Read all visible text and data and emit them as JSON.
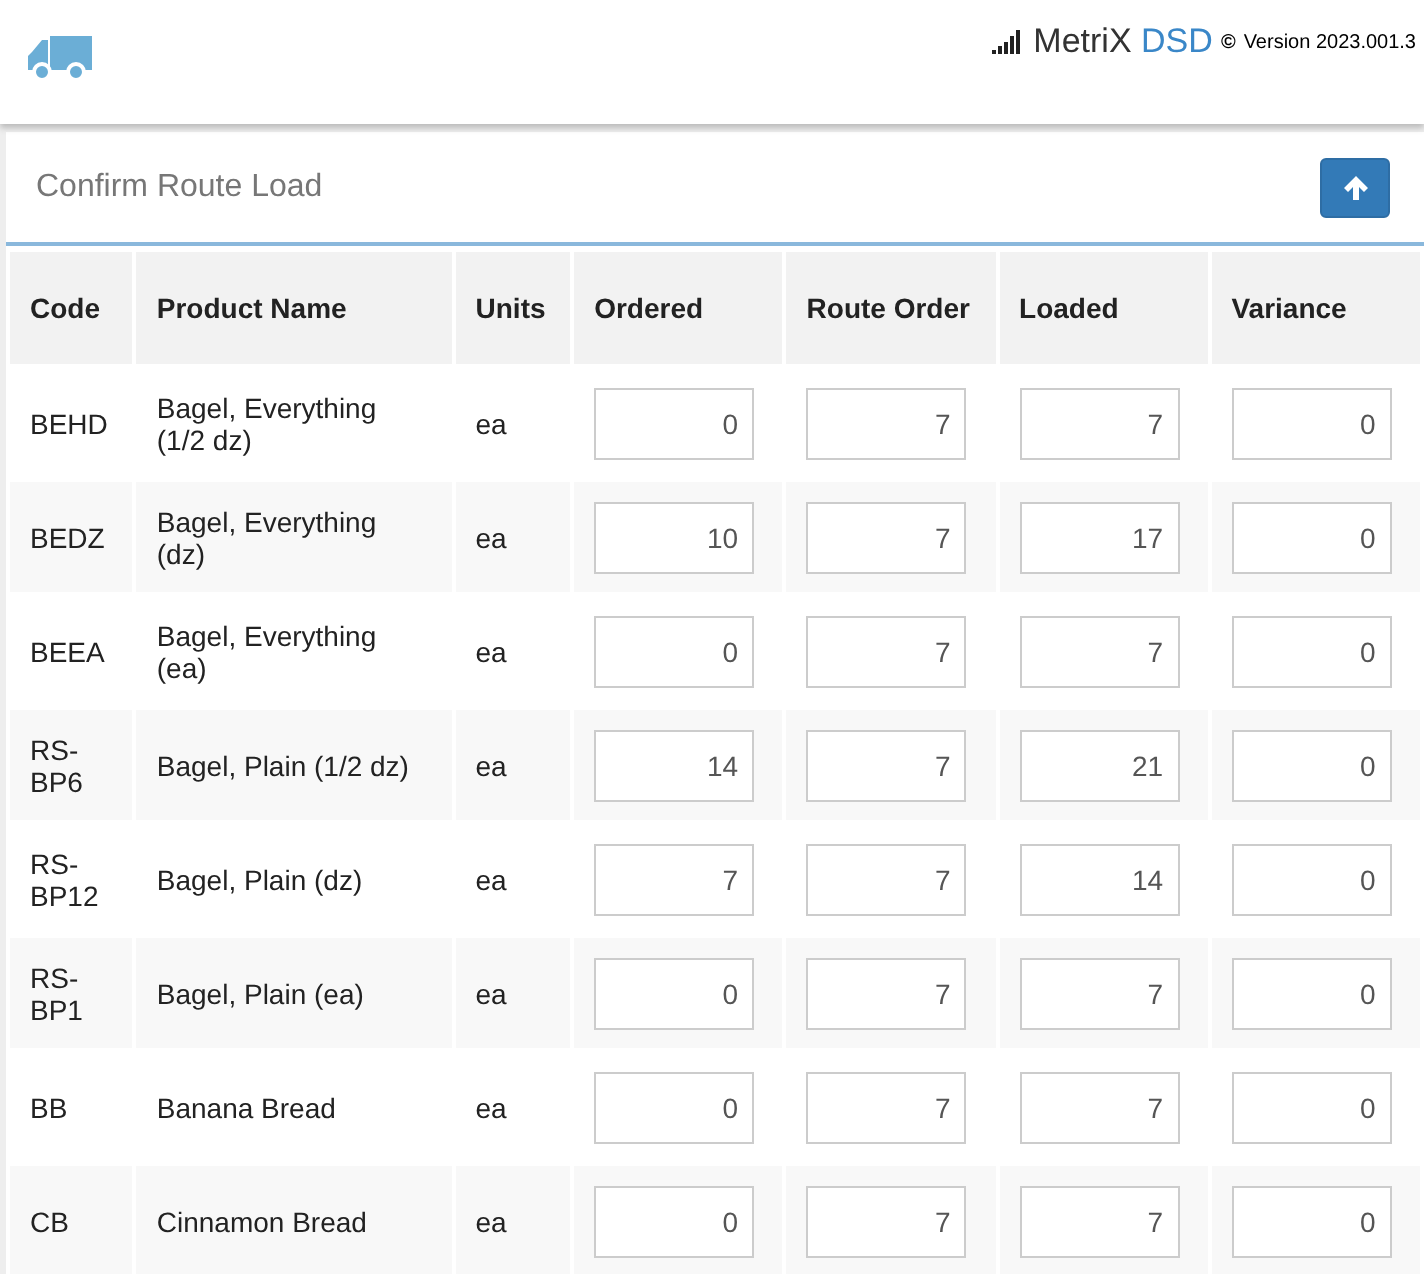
{
  "header": {
    "brand": "MetriX",
    "brand_accent": "DSD",
    "copyright": "©",
    "version": "Version 2023.001.3"
  },
  "panel": {
    "title": "Confirm Route Load"
  },
  "table": {
    "columns": [
      "Code",
      "Product Name",
      "Units",
      "Ordered",
      "Route Order",
      "Loaded",
      "Variance"
    ],
    "rows": [
      {
        "code": "BEHD",
        "name": "Bagel, Everything (1/2 dz)",
        "units": "ea",
        "ordered": "0",
        "route_order": "7",
        "loaded": "7",
        "variance": "0"
      },
      {
        "code": "BEDZ",
        "name": "Bagel, Everything (dz)",
        "units": "ea",
        "ordered": "10",
        "route_order": "7",
        "loaded": "17",
        "variance": "0"
      },
      {
        "code": "BEEA",
        "name": "Bagel, Everything (ea)",
        "units": "ea",
        "ordered": "0",
        "route_order": "7",
        "loaded": "7",
        "variance": "0"
      },
      {
        "code": "RS-BP6",
        "name": "Bagel, Plain (1/2 dz)",
        "units": "ea",
        "ordered": "14",
        "route_order": "7",
        "loaded": "21",
        "variance": "0"
      },
      {
        "code": "RS-BP12",
        "name": "Bagel, Plain (dz)",
        "units": "ea",
        "ordered": "7",
        "route_order": "7",
        "loaded": "14",
        "variance": "0"
      },
      {
        "code": "RS-BP1",
        "name": "Bagel, Plain (ea)",
        "units": "ea",
        "ordered": "0",
        "route_order": "7",
        "loaded": "7",
        "variance": "0"
      },
      {
        "code": "BB",
        "name": "Banana Bread",
        "units": "ea",
        "ordered": "0",
        "route_order": "7",
        "loaded": "7",
        "variance": "0"
      },
      {
        "code": "CB",
        "name": "Cinnamon Bread",
        "units": "ea",
        "ordered": "0",
        "route_order": "7",
        "loaded": "7",
        "variance": "0"
      }
    ]
  }
}
